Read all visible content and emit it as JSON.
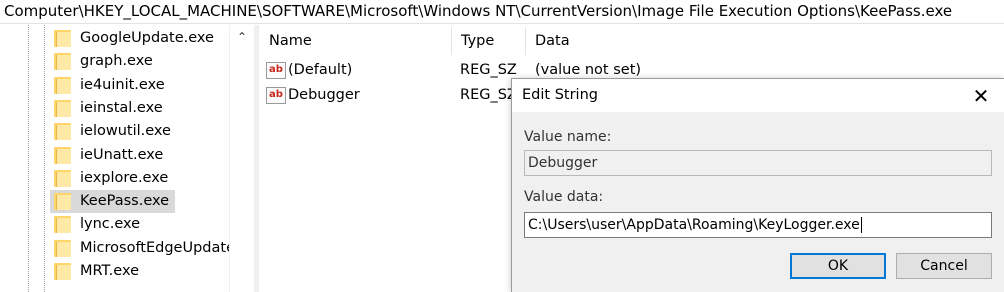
{
  "address_bar": {
    "path": "Computer\\HKEY_LOCAL_MACHINE\\SOFTWARE\\Microsoft\\Windows NT\\CurrentVersion\\Image File Execution Options\\KeePass.exe"
  },
  "tree": {
    "items": [
      {
        "label": "GoogleUpdate.exe",
        "selected": false
      },
      {
        "label": "graph.exe",
        "selected": false
      },
      {
        "label": "ie4uinit.exe",
        "selected": false
      },
      {
        "label": "ieinstal.exe",
        "selected": false
      },
      {
        "label": "ielowutil.exe",
        "selected": false
      },
      {
        "label": "ieUnatt.exe",
        "selected": false
      },
      {
        "label": "iexplore.exe",
        "selected": false
      },
      {
        "label": "KeePass.exe",
        "selected": true
      },
      {
        "label": "lync.exe",
        "selected": false
      },
      {
        "label": "MicrosoftEdgeUpdate",
        "selected": false
      },
      {
        "label": "MRT.exe",
        "selected": false
      }
    ],
    "scroll_up_glyph": "⌃"
  },
  "list": {
    "columns": {
      "name": "Name",
      "type": "Type",
      "data": "Data"
    },
    "rows": [
      {
        "icon_text": "ab",
        "name": "(Default)",
        "type": "REG_SZ",
        "data": "(value not set)"
      },
      {
        "icon_text": "ab",
        "name": "Debugger",
        "type": "REG_SZ",
        "data": ""
      }
    ]
  },
  "dialog": {
    "title": "Edit String",
    "close_glyph": "✕",
    "value_name_label": "Value name:",
    "value_name": "Debugger",
    "value_data_label": "Value data:",
    "value_data": "C:\\Users\\user\\AppData\\Roaming\\KeyLogger.exe",
    "ok_label": "OK",
    "cancel_label": "Cancel",
    "accent_color": "#0078d7"
  },
  "colors": {
    "folder": "#ffd56a",
    "selection": "#d9d9d9",
    "dialog_body": "#f0f0f0",
    "string_icon_red": "#c8281e"
  }
}
